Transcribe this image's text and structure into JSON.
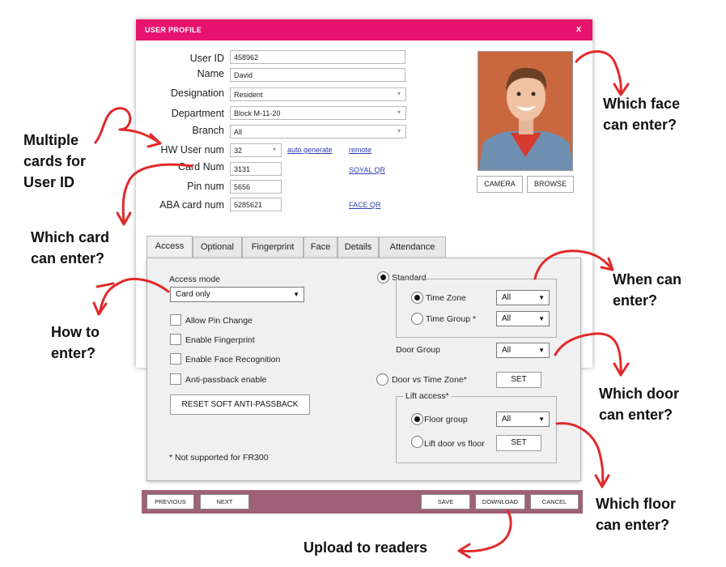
{
  "window": {
    "title": "USER PROFILE",
    "close_label": "x"
  },
  "profile": {
    "user_id": {
      "label": "User ID",
      "value": "458962"
    },
    "name": {
      "label": "Name",
      "value": "David"
    },
    "designation": {
      "label": "Designation",
      "value": "Resident"
    },
    "department": {
      "label": "Department",
      "value": "Block M-11-20"
    },
    "branch": {
      "label": "Branch",
      "value": "All"
    },
    "hw_user_num": {
      "label": "HW User num",
      "value": "32"
    },
    "card_num": {
      "label": "Card Num",
      "value": "3131"
    },
    "pin_num": {
      "label": "Pin num",
      "value": "5656"
    },
    "aba_card_num": {
      "label": "ABA card num",
      "value": "5285621"
    },
    "links": {
      "auto_generate": "auto generate",
      "remote": "remote",
      "soyal_qr": "SOYAL QR",
      "face_qr": "FACE QR"
    },
    "photo_buttons": {
      "camera": "CAMERA",
      "browse": "BROWSE"
    }
  },
  "tabs": [
    "Access",
    "Optional",
    "Fingerprint",
    "Face",
    "Details",
    "Attendance"
  ],
  "access": {
    "access_mode_label": "Access mode",
    "access_mode_value": "Card only",
    "checkboxes": [
      "Allow Pin Change",
      "Enable Fingerprint",
      "Enable Face Recognition",
      "Anti-passback enable"
    ],
    "reset_button": "RESET SOFT ANTI-PASSBACK",
    "footnote": "* Not supported for FR300",
    "standard_label": "Standard",
    "time_zone_label": "Time Zone",
    "time_zone_value": "All",
    "time_group_label": "Time Group *",
    "time_group_value": "All",
    "door_group_label": "Door Group",
    "door_group_value": "All",
    "door_vs_tz_label": "Door vs Time Zone*",
    "set_label": "SET",
    "lift_access_label": "Lift access*",
    "floor_group_label": "Floor group",
    "floor_group_value": "All",
    "lift_door_label": "Lift door vs floor",
    "lift_set_label": "SET"
  },
  "bottom_bar": {
    "previous": "PREVIOUS",
    "next": "NEXT",
    "save": "SAVE",
    "download": "DOWNLOAD",
    "cancel": "CANCEL"
  },
  "annotations": {
    "face": [
      "Which face",
      "can enter?"
    ],
    "multiple_cards": [
      "Multiple",
      "cards for",
      "User ID"
    ],
    "which_card": [
      "Which card",
      "can enter?"
    ],
    "when": [
      "When can",
      "enter?"
    ],
    "how": [
      "How to",
      "enter?"
    ],
    "door": [
      "Which door",
      "can enter?"
    ],
    "floor": [
      "Which floor",
      "can enter?"
    ],
    "upload": "Upload to readers"
  },
  "colors": {
    "titlebar": "#e8136e",
    "bottom_bar": "#9f6178",
    "arrow": "#e02a2a",
    "link": "#2b3fb0"
  }
}
